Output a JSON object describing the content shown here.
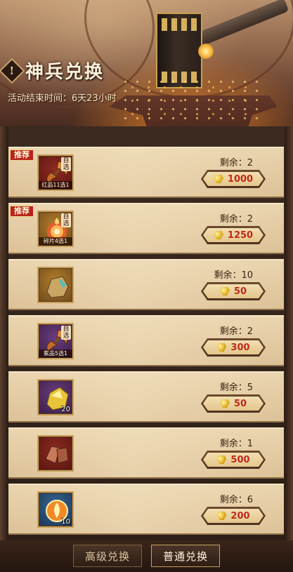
{
  "header": {
    "badge_glyph": "!",
    "title": "神兵兑换",
    "countdown": "活动结束时间：6天23小时"
  },
  "exchange_items": [
    {
      "tag": "推荐",
      "frame": "red",
      "self_select": "自选",
      "caption": "红品11选1",
      "count": "",
      "remaining": "剩余：2",
      "price": "1000",
      "icon": "axe-weapon-icon"
    },
    {
      "tag": "推荐",
      "frame": "gold",
      "self_select": "自选",
      "caption": "碎片4选1",
      "count": "",
      "remaining": "剩余：2",
      "price": "1250",
      "icon": "flame-orb-icon"
    },
    {
      "tag": "",
      "frame": "gold",
      "self_select": "",
      "caption": "",
      "count": "",
      "remaining": "剩余：10",
      "price": "50",
      "icon": "ore-crystal-icon"
    },
    {
      "tag": "",
      "frame": "purple",
      "self_select": "自选",
      "caption": "紫品5选1",
      "count": "",
      "remaining": "剩余：2",
      "price": "300",
      "icon": "axe-weapon-icon"
    },
    {
      "tag": "",
      "frame": "purple",
      "self_select": "",
      "caption": "",
      "count": "20",
      "remaining": "剩余：5",
      "price": "50",
      "icon": "gold-ore-icon"
    },
    {
      "tag": "",
      "frame": "red",
      "self_select": "",
      "caption": "",
      "count": "",
      "remaining": "剩余：1",
      "price": "500",
      "icon": "copper-ore-icon"
    },
    {
      "tag": "",
      "frame": "blue",
      "self_select": "",
      "caption": "",
      "count": "10",
      "remaining": "剩余：6",
      "price": "200",
      "icon": "fire-token-icon"
    }
  ],
  "currency_icon": "gold-ingot-icon",
  "tabs": {
    "advanced": "高级兑换",
    "normal": "普通兑换",
    "active": "normal"
  },
  "colors": {
    "price_text": "#c1291b",
    "tag_bg": "#b8231a",
    "row_bg": "#e9d4ae"
  }
}
